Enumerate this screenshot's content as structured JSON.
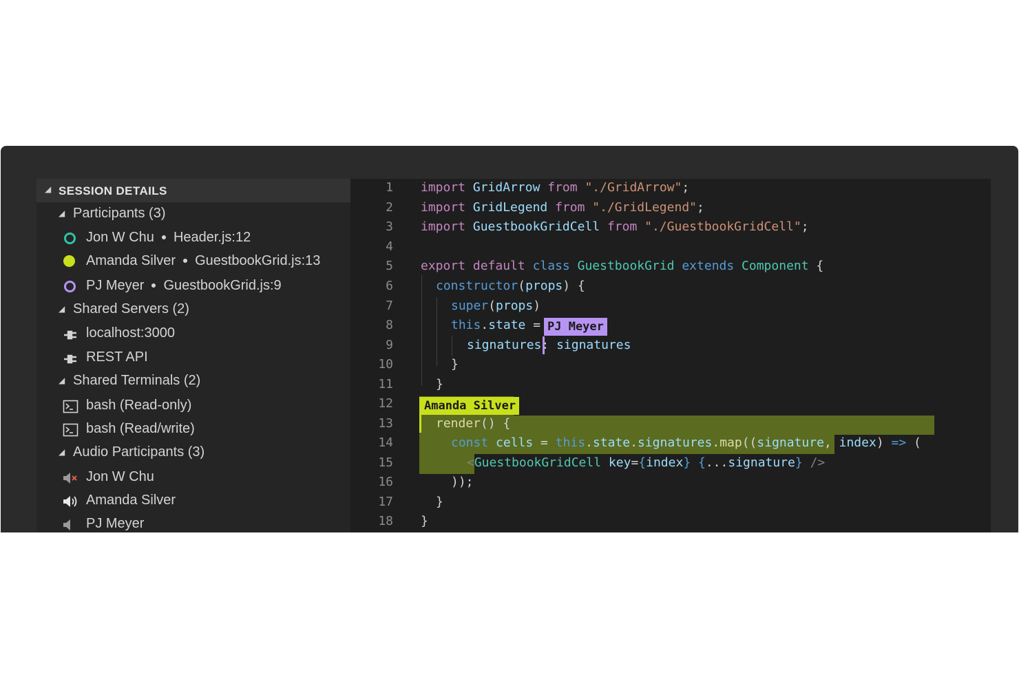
{
  "colors": {
    "window_bg": "#2b2b2c",
    "sidebar_bg": "#252526",
    "editor_bg": "#1e1e1e",
    "jon_color": "#2ec4a6",
    "amanda_color": "#c8e01c",
    "pj_color": "#b794f4",
    "amanda_highlight": "#5b6b1f"
  },
  "sidebar": {
    "title": "SESSION DETAILS",
    "participants": {
      "label": "Participants (3)",
      "items": [
        {
          "name": "Jon W Chu",
          "location": "Header.js:12",
          "icon": "follow-ring-icon"
        },
        {
          "name": "Amanda Silver",
          "location": "GuestbookGrid.js:13",
          "icon": "filled-dot-icon"
        },
        {
          "name": "PJ Meyer",
          "location": "GuestbookGrid.js:9",
          "icon": "follow-ring-icon"
        }
      ]
    },
    "servers": {
      "label": "Shared Servers (2)",
      "items": [
        {
          "name": "localhost:3000",
          "icon": "plug-icon"
        },
        {
          "name": "REST API",
          "icon": "plug-icon"
        }
      ]
    },
    "terminals": {
      "label": "Shared Terminals (2)",
      "items": [
        {
          "name": "bash (Read-only)",
          "icon": "terminal-icon"
        },
        {
          "name": "bash (Read/write)",
          "icon": "terminal-icon"
        }
      ]
    },
    "audio": {
      "label": "Audio Participants (3)",
      "items": [
        {
          "name": "Jon W Chu",
          "icon": "speaker-muted-icon"
        },
        {
          "name": "Amanda Silver",
          "icon": "speaker-active-icon"
        },
        {
          "name": "PJ Meyer",
          "icon": "speaker-icon"
        }
      ]
    }
  },
  "editor": {
    "line_numbers": [
      "1",
      "2",
      "3",
      "4",
      "5",
      "6",
      "7",
      "8",
      "9",
      "10",
      "11",
      "12",
      "13",
      "14",
      "15",
      "16",
      "17",
      "18"
    ],
    "cursors": {
      "pj": "PJ Meyer",
      "amanda": "Amanda Silver"
    },
    "tokens": {
      "l1": [
        "import",
        " GridArrow ",
        "from",
        " \"./GridArrow\"",
        ";"
      ],
      "l2": [
        "import",
        " GridLegend ",
        "from",
        " \"./GridLegend\"",
        ";"
      ],
      "l3": [
        "import",
        " GuestbookGridCell ",
        "from",
        " \"./GuestbookGridCell\"",
        ";"
      ],
      "l5": [
        "export",
        " ",
        "default",
        " ",
        "class",
        " ",
        "GuestbookGrid",
        " ",
        "extends",
        " ",
        "Component",
        " {"
      ],
      "l6": [
        "constructor",
        "(",
        "props",
        ") {"
      ],
      "l7": [
        "super",
        "(",
        "props",
        ")"
      ],
      "l8": [
        "this",
        ".",
        "state",
        " ="
      ],
      "l9": [
        "signatures",
        ": ",
        "signatures"
      ],
      "l10": [
        "}"
      ],
      "l11": [
        "}"
      ],
      "l13": [
        "render",
        "() {"
      ],
      "l14": [
        "const",
        " ",
        "cells",
        " = ",
        "this",
        ".",
        "state",
        ".",
        "signatures",
        ".",
        "map",
        "((",
        "signature",
        ", ",
        "index",
        ") ",
        "=>",
        " ("
      ],
      "l15": [
        "<",
        "GuestbookGridCell",
        " ",
        "key",
        "=",
        "{",
        "index",
        "}",
        " ",
        "{",
        "...",
        "signature",
        "}",
        " />"
      ],
      "l16": [
        "));"
      ],
      "l17": [
        "}"
      ],
      "l18": [
        "}"
      ]
    }
  }
}
